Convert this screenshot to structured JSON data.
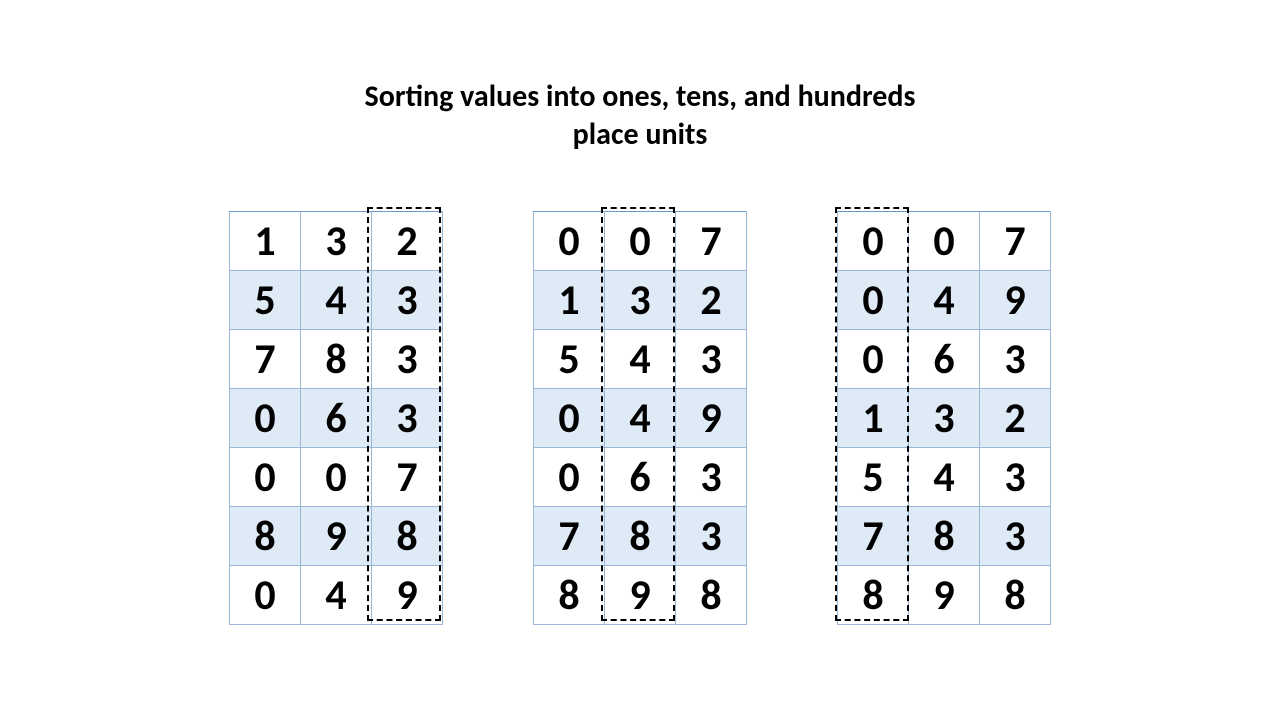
{
  "title_line1": "Sorting values into ones, tens, and hundreds",
  "title_line2": "place units",
  "tables": [
    {
      "highlight_col": 2,
      "rows": [
        [
          "1",
          "3",
          "2"
        ],
        [
          "5",
          "4",
          "3"
        ],
        [
          "7",
          "8",
          "3"
        ],
        [
          "0",
          "6",
          "3"
        ],
        [
          "0",
          "0",
          "7"
        ],
        [
          "8",
          "9",
          "8"
        ],
        [
          "0",
          "4",
          "9"
        ]
      ]
    },
    {
      "highlight_col": 1,
      "rows": [
        [
          "0",
          "0",
          "7"
        ],
        [
          "1",
          "3",
          "2"
        ],
        [
          "5",
          "4",
          "3"
        ],
        [
          "0",
          "4",
          "9"
        ],
        [
          "0",
          "6",
          "3"
        ],
        [
          "7",
          "8",
          "3"
        ],
        [
          "8",
          "9",
          "8"
        ]
      ]
    },
    {
      "highlight_col": 0,
      "rows": [
        [
          "0",
          "0",
          "7"
        ],
        [
          "0",
          "4",
          "9"
        ],
        [
          "0",
          "6",
          "3"
        ],
        [
          "1",
          "3",
          "2"
        ],
        [
          "5",
          "4",
          "3"
        ],
        [
          "7",
          "8",
          "3"
        ],
        [
          "8",
          "9",
          "8"
        ]
      ]
    }
  ]
}
